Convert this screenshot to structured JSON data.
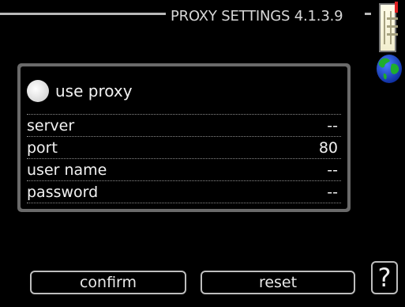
{
  "header": {
    "title": "PROXY SETTINGS 4.1.3.9"
  },
  "icons": {
    "scroll_indicator": "scroll-indicator-icon",
    "globe": "globe-icon",
    "help": "help-icon"
  },
  "use_proxy": {
    "label": "use proxy",
    "checked": false
  },
  "settings": [
    {
      "label": "server",
      "value": "--"
    },
    {
      "label": "port",
      "value": "80"
    },
    {
      "label": "user name",
      "value": "--"
    },
    {
      "label": "password",
      "value": "--"
    }
  ],
  "buttons": {
    "confirm": "confirm",
    "reset": "reset",
    "help": "?"
  },
  "colors": {
    "background": "#000000",
    "panel_border": "#6a6a6a",
    "text": "#f2f2f2",
    "scroll_indicator": "#fffce8",
    "accent_red": "#e02020"
  }
}
